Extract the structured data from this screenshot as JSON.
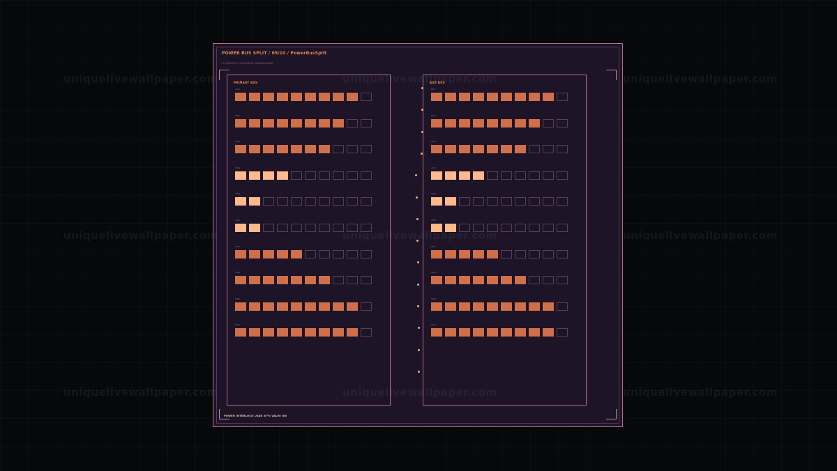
{
  "watermark": {
    "text": "uniquelivewallpaper.com"
  },
  "dashboard": {
    "title": "POWER BUS SPLIT  /  09/10  /  PowerBusSplit",
    "subtitle": "FUTURISTIC SPACESHIP DASHBOARD",
    "footer": "POWER INTERLOCK  LOAD #7%  VALVE ON",
    "colors": {
      "panel_bg": "#1d1428",
      "border": "#b8708a",
      "accent": "#e88a52",
      "cell_on": "#d0704a",
      "cell_hot": "#ffb98a",
      "cell_off_border": "#5a3d5c",
      "dot": "#f0b080"
    }
  },
  "buses": [
    {
      "name": "PRIMARY BUS",
      "segments_per_row": 10,
      "rows": [
        {
          "label": "CH01",
          "level": 9,
          "state": "normal"
        },
        {
          "label": "CH02",
          "level": 8,
          "state": "normal"
        },
        {
          "label": "CH03",
          "level": 7,
          "state": "normal"
        },
        {
          "label": "CH04",
          "level": 4,
          "state": "high"
        },
        {
          "label": "CH05",
          "level": 2,
          "state": "high"
        },
        {
          "label": "CH06",
          "level": 2,
          "state": "high"
        },
        {
          "label": "CH07",
          "level": 5,
          "state": "normal"
        },
        {
          "label": "CH08",
          "level": 7,
          "state": "normal"
        },
        {
          "label": "CH09",
          "level": 9,
          "state": "normal"
        },
        {
          "label": "CH10",
          "level": 9,
          "state": "normal"
        }
      ]
    },
    {
      "name": "AUX BUS",
      "segments_per_row": 10,
      "rows": [
        {
          "label": "AX01",
          "level": 9,
          "state": "normal"
        },
        {
          "label": "AX02",
          "level": 8,
          "state": "normal"
        },
        {
          "label": "AX03",
          "level": 7,
          "state": "normal"
        },
        {
          "label": "AX04",
          "level": 4,
          "state": "high"
        },
        {
          "label": "AX05",
          "level": 2,
          "state": "high"
        },
        {
          "label": "AX06",
          "level": 2,
          "state": "high"
        },
        {
          "label": "AX07",
          "level": 5,
          "state": "normal"
        },
        {
          "label": "AX08",
          "level": 7,
          "state": "normal"
        },
        {
          "label": "AX09",
          "level": 9,
          "state": "normal"
        },
        {
          "label": "AX10",
          "level": 9,
          "state": "normal"
        }
      ]
    }
  ],
  "connector": {
    "dot_count": 14
  }
}
